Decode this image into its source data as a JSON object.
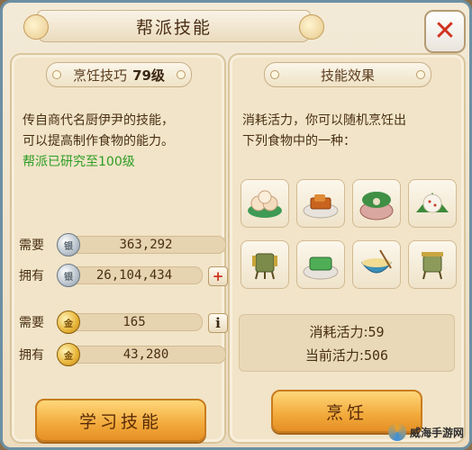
{
  "window": {
    "title": "帮派技能"
  },
  "left": {
    "skill_name": "烹饪技巧",
    "skill_level": "79级",
    "desc_line1": "传自商代名厨伊尹的技能，",
    "desc_line2": "可以提高制作食物的能力。",
    "research_status": "帮派已研究至100级",
    "resources": [
      {
        "label": "需要",
        "coin": "silver",
        "value": "363,292"
      },
      {
        "label": "拥有",
        "coin": "silver",
        "value": "26,104,434",
        "action": "+"
      },
      {
        "label": "需要",
        "coin": "gold",
        "value": "165",
        "action": "i"
      },
      {
        "label": "拥有",
        "coin": "gold",
        "value": "43,280"
      }
    ],
    "learn_button": "学习技能"
  },
  "right": {
    "header": "技能效果",
    "desc_line1": "消耗活力，你可以随机烹饪出",
    "desc_line2": "下列食物中的一种：",
    "foods": [
      "steamed-buns",
      "braised-tofu",
      "cabbage-dish",
      "sticky-rice-dumpling",
      "wine-cup",
      "green-cake",
      "noodle-bowl",
      "bronze-vessel"
    ],
    "stats": {
      "cost_label": "消耗活力:",
      "cost_value": "59",
      "current_label": "当前活力:",
      "current_value": "506"
    },
    "cook_button": "烹饪"
  },
  "watermark": "威海手游网",
  "colors": {
    "accent": "#f2a93a",
    "green_text": "#2e9d24",
    "close": "#d0331f"
  }
}
